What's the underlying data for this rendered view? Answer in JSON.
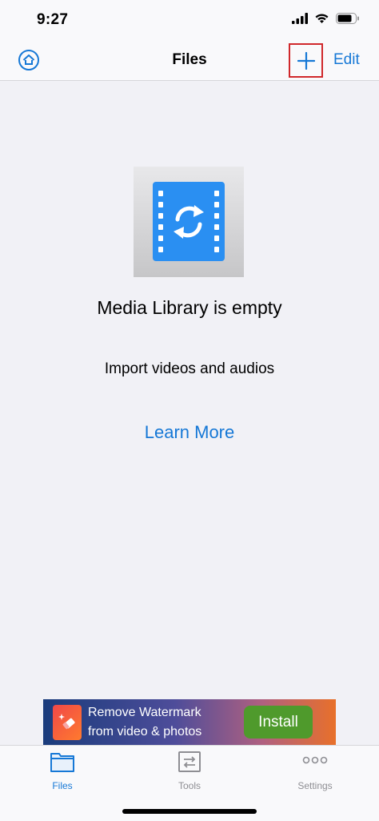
{
  "status_bar": {
    "time": "9:27"
  },
  "nav": {
    "title": "Files",
    "edit_label": "Edit"
  },
  "empty_state": {
    "title": "Media Library is empty",
    "subtitle": "Import videos and audios",
    "link": "Learn More"
  },
  "ad": {
    "line1": "Remove Watermark",
    "line2": "from video & photos",
    "button": "Install"
  },
  "tabs": [
    {
      "label": "Files",
      "icon": "folder-icon",
      "active": true
    },
    {
      "label": "Tools",
      "icon": "tools-icon",
      "active": false
    },
    {
      "label": "Settings",
      "icon": "more-icon",
      "active": false
    }
  ],
  "colors": {
    "accent": "#1678d6",
    "highlight": "#d0282b",
    "inactive": "#8e8e93"
  }
}
